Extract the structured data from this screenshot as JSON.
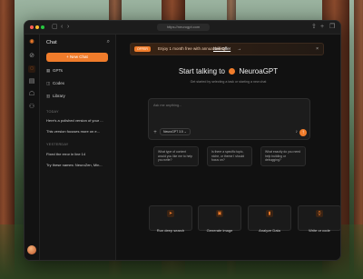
{
  "browser": {
    "url": "https://neurogpt.com"
  },
  "sidebar": {
    "title": "Chat",
    "new_chat": "+ New Chat",
    "nav": [
      {
        "label": "GPTs",
        "icon": "grid-icon"
      },
      {
        "label": "Codex",
        "icon": "code-icon"
      },
      {
        "label": "Library",
        "icon": "book-icon"
      }
    ],
    "today_label": "TODAY",
    "today": [
      "Here's a polished version of your ...",
      "This version focuses more on e..."
    ],
    "yesterday_label": "YESTERDAY",
    "yesterday": [
      "Fixed the error in line 14",
      "Try these names: NeuroZen, Min..."
    ]
  },
  "banner": {
    "badge": "OFFER",
    "text": "Enjoy 1 month free with annual billing",
    "offer": "See Offer",
    "arrow": "→",
    "close": "×"
  },
  "hero": {
    "title_prefix": "Start talking to",
    "brand": "NeuroaGPT",
    "subtitle": "Get started by selecting a task or starting a new chat"
  },
  "composer": {
    "placeholder": "Ask me anything...",
    "model": "NeuroGPT 3.5 ⌄"
  },
  "suggestions": [
    "What type of content would you like me to help you write?",
    "Is there a specific topic, niche, or theme I should focus on?",
    "What exactly do you need help building or debugging?"
  ],
  "actions": [
    {
      "label": "Run deep search",
      "icon": "send-icon"
    },
    {
      "label": "Generate image",
      "icon": "image-icon"
    },
    {
      "label": "Analyze Data",
      "icon": "chart-icon"
    },
    {
      "label": "Write or code",
      "icon": "code-icon"
    }
  ],
  "colors": {
    "accent": "#f07c2b",
    "window": "#141414"
  }
}
